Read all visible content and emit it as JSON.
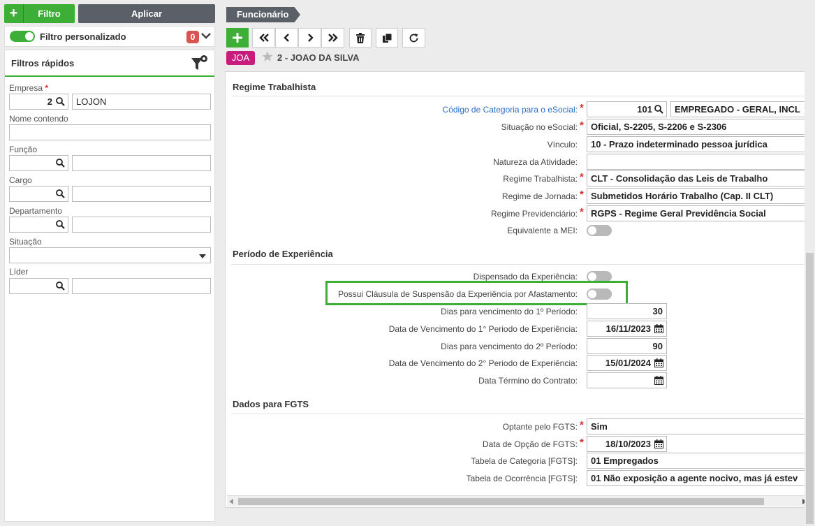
{
  "left": {
    "filtro_btn": "Filtro",
    "aplicar_btn": "Aplicar",
    "filtro_personalizado": "Filtro personalizado",
    "badge_count": "0",
    "quick_filters_title": "Filtros rápidos",
    "empresa_label": "Empresa",
    "empresa_code": "2",
    "empresa_name": "LOJON",
    "nome_label": "Nome contendo",
    "funcao_label": "Função",
    "cargo_label": "Cargo",
    "departamento_label": "Departamento",
    "situacao_label": "Situação",
    "lider_label": "Líder"
  },
  "header": {
    "breadcrumb": "Funcionário",
    "tag": "JOA",
    "record_title": "2 - JOAO DA SILVA"
  },
  "regime": {
    "section_title": "Regime Trabalhista",
    "codigo_label": "Código de Categoria para o eSocial:",
    "codigo_value": "101",
    "codigo_desc": "EMPREGADO - GERAL, INCL",
    "situacao_label": "Situação no eSocial:",
    "situacao_value": "Oficial, S-2205, S-2206 e S-2306",
    "vinculo_label": "Vínculo:",
    "vinculo_value": "10 - Prazo indeterminado pessoa jurídica",
    "natureza_label": "Natureza da Atividade:",
    "natureza_value": "",
    "regime_trab_label": "Regime Trabalhista:",
    "regime_trab_value": "CLT - Consolidação das Leis de Trabalho",
    "jornada_label": "Regime de Jornada:",
    "jornada_value": "Submetidos Horário Trabalho (Cap. II CLT)",
    "prev_label": "Regime Previdenciário:",
    "prev_value": "RGPS - Regime Geral Previdência Social",
    "mei_label": "Equivalente a MEI:"
  },
  "experiencia": {
    "section_title": "Período de Experiência",
    "dispensado_label": "Dispensado da Experiência:",
    "clausula_label": "Possui Cláusula de Suspensão da Experiência por Afastamento:",
    "dias1_label": "Dias para vencimento do 1º Período:",
    "dias1_value": "30",
    "data1_label": "Data de Vencimento do 1° Periodo de Experiência:",
    "data1_value": "16/11/2023",
    "dias2_label": "Dias para vencimento do 2º Período:",
    "dias2_value": "90",
    "data2_label": "Data de Vencimento do 2° Periodo de Experiência:",
    "data2_value": "15/01/2024",
    "termino_label": "Data Término do Contrato:",
    "termino_value": ""
  },
  "fgts": {
    "section_title": "Dados para FGTS",
    "optante_label": "Optante pelo FGTS:",
    "optante_value": "Sim",
    "data_opcao_label": "Data de Opção de FGTS:",
    "data_opcao_value": "18/10/2023",
    "tab_categoria_label": "Tabela de Categoria [FGTS]:",
    "tab_categoria_value": "01 Empregados",
    "tab_ocorrencia_label": "Tabela de Ocorrência [FGTS]:",
    "tab_ocorrencia_value": "01 Não exposição a agente nocivo, mas já estev"
  },
  "colors": {
    "accent_green": "#3dae36",
    "dark_button": "#5b6068",
    "tag_magenta": "#c81c7c",
    "required_red": "#d9302c",
    "link_blue": "#2a6fc9"
  }
}
